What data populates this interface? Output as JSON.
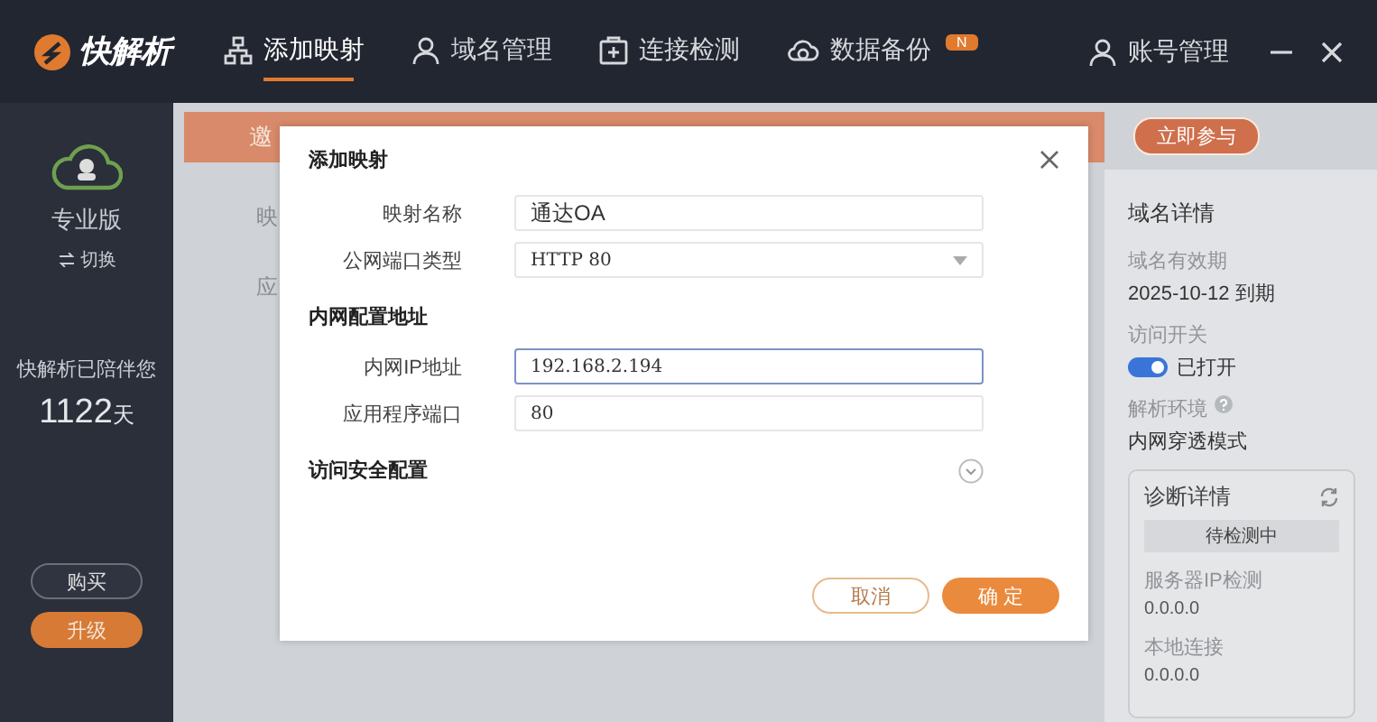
{
  "app": {
    "logo": "快解析"
  },
  "nav": [
    {
      "label": "添加映射",
      "selected": true
    },
    {
      "label": "域名管理",
      "selected": false
    },
    {
      "label": "连接检测",
      "selected": false
    },
    {
      "label": "数据备份",
      "selected": false,
      "badge": "N"
    }
  ],
  "account": {
    "label": "账号管理"
  },
  "sidebar": {
    "edition": "专业版",
    "switch": "切换",
    "companion_text": "快解析已陪伴您",
    "days": "1122",
    "days_unit": "天",
    "buttons": [
      {
        "label": "购买",
        "kind": "outline"
      },
      {
        "label": "升级",
        "kind": "filled"
      }
    ]
  },
  "banner": {
    "text": "邀",
    "button": "立即参与"
  },
  "background_labels": [
    "映",
    "应"
  ],
  "dialog": {
    "title": "添加映射",
    "fields": [
      {
        "label": "映射名称",
        "value": "通达OA",
        "focused": false
      },
      {
        "label": "公网端口类型",
        "value": "HTTP 80",
        "kind": "select",
        "focused": false
      }
    ],
    "sections": [
      {
        "title": "内网配置地址",
        "fields": [
          {
            "label": "内网IP地址",
            "value": "192.168.2.194",
            "focused": true
          },
          {
            "label": "应用程序端口",
            "value": "80",
            "focused": false
          }
        ]
      },
      {
        "title": "访问安全配置",
        "expanded": false
      }
    ],
    "buttons": [
      {
        "label": "取消",
        "kind": "outline"
      },
      {
        "label": "确 定",
        "kind": "filled"
      }
    ]
  },
  "detail": {
    "title": "域名详情",
    "items": [
      {
        "label": "域名有效期",
        "value": "2025-10-12 到期"
      },
      {
        "label": "访问开关",
        "value": "已打开",
        "kind": "toggle",
        "on": true
      },
      {
        "label": "解析环境",
        "value": "内网穿透模式",
        "kind": "help"
      }
    ],
    "diagnosis": {
      "title": "诊断详情",
      "status": "待检测中",
      "items": [
        {
          "label": "服务器IP检测",
          "value": "0.0.0.0"
        },
        {
          "label": "本地连接",
          "value": "0.0.0.0"
        }
      ]
    }
  }
}
